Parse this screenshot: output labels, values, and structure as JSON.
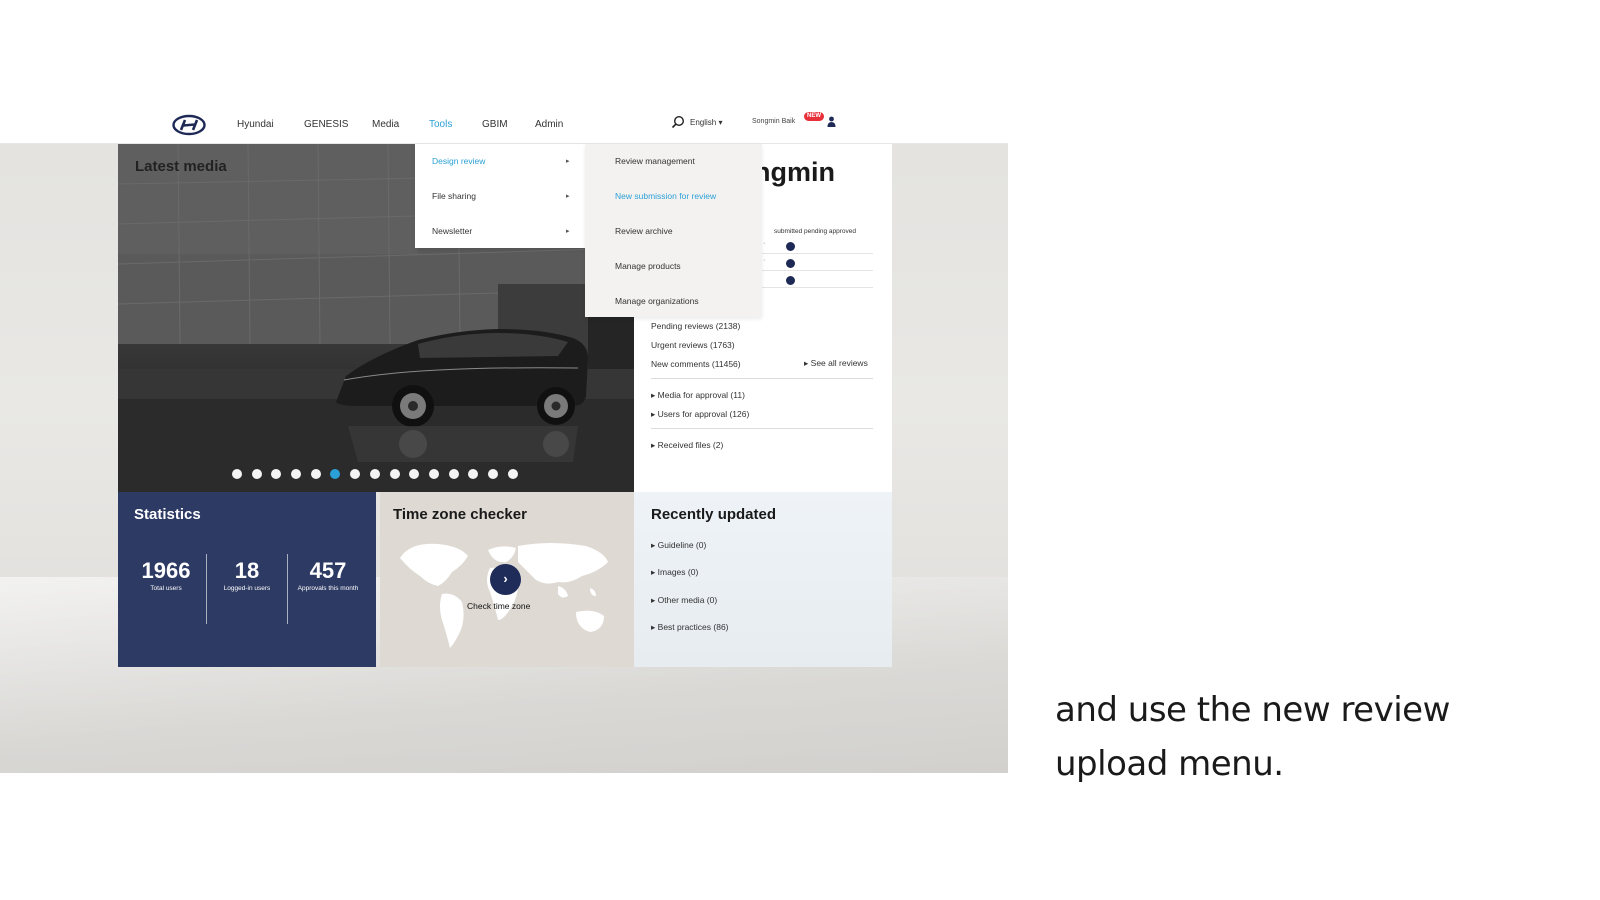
{
  "nav": {
    "items": [
      "Hyundai",
      "GENESIS",
      "Media",
      "Tools",
      "GBIM",
      "Admin"
    ],
    "active": "Tools",
    "language": "English",
    "user": "Songmin Baik",
    "badge": "NEW"
  },
  "latest_media": {
    "title": "Latest media",
    "slide_count": 15,
    "active_slide": 6
  },
  "welcome": {
    "name": "ngmin",
    "status_header": "submitted  pending  approved",
    "reviews": [
      "Pending reviews (2138)",
      "Urgent reviews (1763)",
      "New comments (11456)"
    ],
    "see_all": "See all reviews",
    "approvals": [
      "Media for approval (11)",
      "Users for approval (126)"
    ],
    "received": "Received files (2)"
  },
  "tools_menu": {
    "left": [
      {
        "label": "Design review",
        "arrow": "▸"
      },
      {
        "label": "File sharing",
        "arrow": "▸"
      },
      {
        "label": "Newsletter",
        "arrow": "▸"
      }
    ],
    "right": [
      "Review management",
      "New submission for review",
      "Review archive",
      "Manage products",
      "Manage organizations"
    ],
    "active_left": "Design review",
    "active_right": "New submission for review"
  },
  "statistics": {
    "title": "Statistics",
    "items": [
      {
        "value": "1966",
        "label": "Total users"
      },
      {
        "value": "18",
        "label": "Logged-in users"
      },
      {
        "value": "457",
        "label": "Approvals this month"
      }
    ]
  },
  "timezone": {
    "title": "Time zone checker",
    "button": "›",
    "label": "Check time zone"
  },
  "recent": {
    "title": "Recently updated",
    "items": [
      "Guideline (0)",
      "Images (0)",
      "Other media (0)",
      "Best practices (86)"
    ]
  },
  "caption": {
    "line1": "and use the new review",
    "line2": "upload menu."
  },
  "colors": {
    "accent": "#2aa0d6",
    "navy": "#2d3a63",
    "badge": "#e8303a"
  }
}
